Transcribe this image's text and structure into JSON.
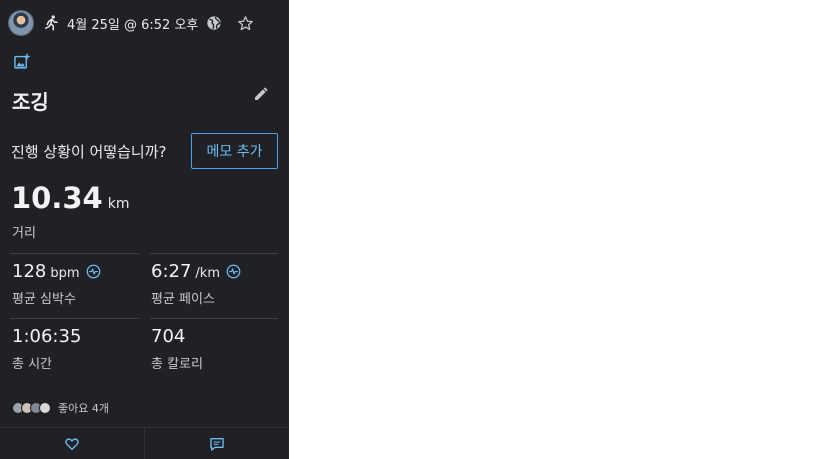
{
  "header": {
    "date_time": "4월 25일 @ 6:52 오후",
    "icons": [
      "avatar",
      "run-icon",
      "globe-icon",
      "star-icon"
    ]
  },
  "actions": {
    "add_photo_icon": "add-photo-icon",
    "edit_icon": "pencil-icon"
  },
  "activity": {
    "title": "조깅",
    "prompt": "진행 상황이 어떻습니까?",
    "memo_button": "메모 추가"
  },
  "stats": {
    "distance": {
      "value": "10.34",
      "unit": "km",
      "label": "거리"
    },
    "heart_rate": {
      "value": "128",
      "unit": "bpm",
      "label": "평균 심박수"
    },
    "pace": {
      "value": "6:27",
      "unit": "/km",
      "label": "평균 페이스"
    },
    "time": {
      "value": "1:06:35",
      "label": "총 시간"
    },
    "calories": {
      "value": "704",
      "label": "총 칼로리"
    }
  },
  "social": {
    "likes_text": "좋아요 4개"
  },
  "bottom_bar": {
    "icons": [
      "heart-icon",
      "comment-icon"
    ]
  },
  "colors": {
    "panel_background": "#202124",
    "accent": "#4aa3e8",
    "text": "#e8eaed"
  }
}
